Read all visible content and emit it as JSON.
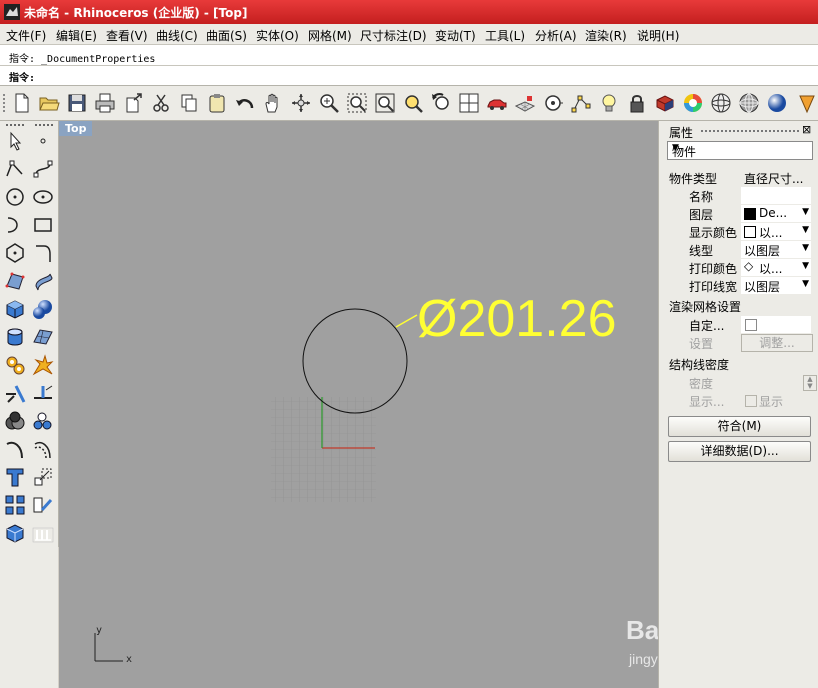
{
  "window": {
    "title": "未命名 - Rhinoceros (企业版) - [Top]"
  },
  "menu": [
    "文件(F)",
    "编辑(E)",
    "查看(V)",
    "曲线(C)",
    "曲面(S)",
    "实体(O)",
    "网格(M)",
    "尺寸标注(D)",
    "变动(T)",
    "工具(L)",
    "分析(A)",
    "渲染(R)",
    "说明(H)"
  ],
  "command": {
    "history": "指令: _DocumentProperties",
    "prompt": "指令:",
    "input_value": ""
  },
  "toolbar_icons": [
    "new-file-icon",
    "open-folder-icon",
    "save-icon",
    "print-icon",
    "export-icon",
    "cut-icon",
    "copy-icon",
    "paste-icon",
    "undo-icon",
    "pan-hand-icon",
    "rotate-view-icon",
    "zoom-dynamic-icon",
    "zoom-window-icon",
    "zoom-extents-icon",
    "zoom-selected-icon",
    "undo-view-icon",
    "four-viewports-icon",
    "car-icon",
    "grid-plane-icon",
    "point-osnap-icon",
    "select-points-icon",
    "light-bulb-icon",
    "lock-icon",
    "shaded-sphere-icon",
    "color-wheel-icon",
    "wireframe-sphere-icon",
    "mesh-sphere-icon",
    "render-sphere-icon",
    "render-icon"
  ],
  "left_toolbar_icons": [
    "select-arrow-icon",
    "point-icon",
    "polyline-icon",
    "curve-point-icon",
    "circle-icon",
    "ellipse-icon",
    "arc-icon",
    "rectangle-icon",
    "polygon-icon",
    "fillet-curve-icon",
    "surface-from-points-icon",
    "extrude-surface-icon",
    "box-solid-icon",
    "sphere-solid-icon",
    "cylinder-solid-icon",
    "plane-surface-icon",
    "gear-solid-icon",
    "explode-icon",
    "split-icon",
    "trim-icon",
    "boolean-icon",
    "points-cloud-icon",
    "curve-tool-icon",
    "offset-curve-icon",
    "text-icon",
    "scale-icon",
    "array-icon",
    "orient-icon",
    "mesh-box-icon",
    "dimension-icon"
  ],
  "viewport": {
    "label": "Top",
    "dimension_text": "Ø201.26",
    "axis_x": "x",
    "axis_y": "y"
  },
  "colors": {
    "accent_title": "#c41f1f",
    "dimension": "#ffff33",
    "viewport_bg": "#a0a0a0",
    "axis_x": "#c0392b",
    "axis_y": "#2a9a2a"
  },
  "panel": {
    "title": "属性",
    "selector": "物件",
    "rows": {
      "type_label": "物件类型",
      "type_value": "直径尺寸...",
      "name_label": "名称",
      "name_value": "",
      "layer_label": "图层",
      "layer_value": "De...",
      "display_color_label": "显示颜色",
      "display_color_value": "以...",
      "linetype_label": "线型",
      "linetype_value": "以图层",
      "print_color_label": "打印颜色",
      "print_color_value": "以...",
      "print_width_label": "打印线宽",
      "print_width_value": "以图层"
    },
    "render_mesh": {
      "section": "渲染网格设置",
      "custom_label": "自定...",
      "settings_label": "设置",
      "adjust_button": "调整..."
    },
    "isocurve": {
      "section": "结构线密度",
      "density_label": "密度",
      "show_label": "显示...",
      "show_check_label": "显示"
    },
    "match_button": "符合(M)",
    "details_button": "详细数据(D)..."
  },
  "watermark": {
    "line1": "Bai du 经验",
    "line2": "jingyan.baidu.com"
  }
}
